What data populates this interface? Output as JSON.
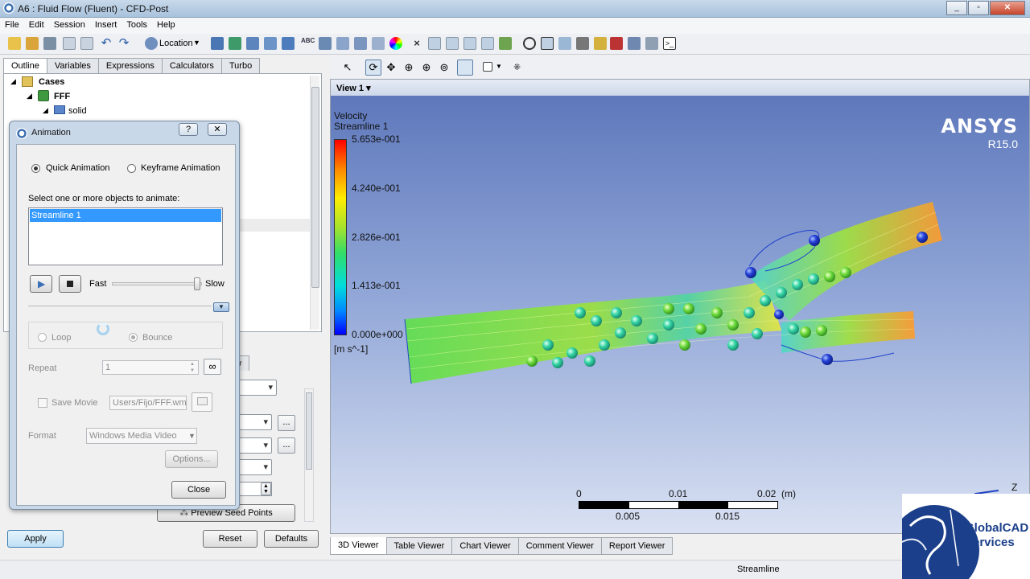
{
  "window": {
    "title": "A6 : Fluid Flow (Fluent) - CFD-Post"
  },
  "menu": [
    "File",
    "Edit",
    "Session",
    "Insert",
    "Tools",
    "Help"
  ],
  "toolbar": {
    "location_label": "Location"
  },
  "left_tabs": [
    "Outline",
    "Variables",
    "Expressions",
    "Calculators",
    "Turbo"
  ],
  "tree": {
    "root": "Cases",
    "case": "FFF",
    "domain": "solid"
  },
  "details": {
    "preview_button": "Preview Seed Points",
    "partial_tab": "w"
  },
  "bottom_buttons": {
    "apply": "Apply",
    "reset": "Reset",
    "defaults": "Defaults"
  },
  "dialog": {
    "title": "Animation",
    "help": "?",
    "close_x": "✕",
    "quick_animation": "Quick Animation",
    "keyframe_animation": "Keyframe Animation",
    "select_prompt": "Select one or more objects to animate:",
    "objects": [
      "Streamline 1"
    ],
    "fast": "Fast",
    "slow": "Slow",
    "speed_level": 0.95,
    "loop": "Loop",
    "bounce": "Bounce",
    "repeat_label": "Repeat",
    "repeat_value": "1",
    "infinite_symbol": "∞",
    "save_movie": "Save Movie",
    "movie_path": "Users/Fijo/FFF.wmv",
    "format_label": "Format",
    "format_value": "Windows Media Video",
    "options_button": "Options...",
    "close_button": "Close"
  },
  "viewer": {
    "view_label": "View 1",
    "legend": {
      "title": "Velocity",
      "subtitle": "Streamline 1",
      "ticks": [
        "5.653e-001",
        "4.240e-001",
        "2.826e-001",
        "1.413e-001",
        "0.000e+000"
      ],
      "unit": "[m s^-1]"
    },
    "brand": "ANSYS",
    "version": "R15.0",
    "scale": {
      "top_ticks": [
        "0",
        "0.01",
        "0.02"
      ],
      "unit": "(m)",
      "bottom_ticks": [
        "0.005",
        "0.015"
      ]
    },
    "axis_label": "Z"
  },
  "viewer_tabs": [
    "3D Viewer",
    "Table Viewer",
    "Chart Viewer",
    "Comment Viewer",
    "Report Viewer"
  ],
  "status": {
    "text": "Streamline"
  },
  "watermark": {
    "line1": "GlobalCAD",
    "line2": "Services"
  },
  "colors": {
    "accent": "#3399ff",
    "legend_high": "#ff0000",
    "legend_low": "#0000ff"
  }
}
